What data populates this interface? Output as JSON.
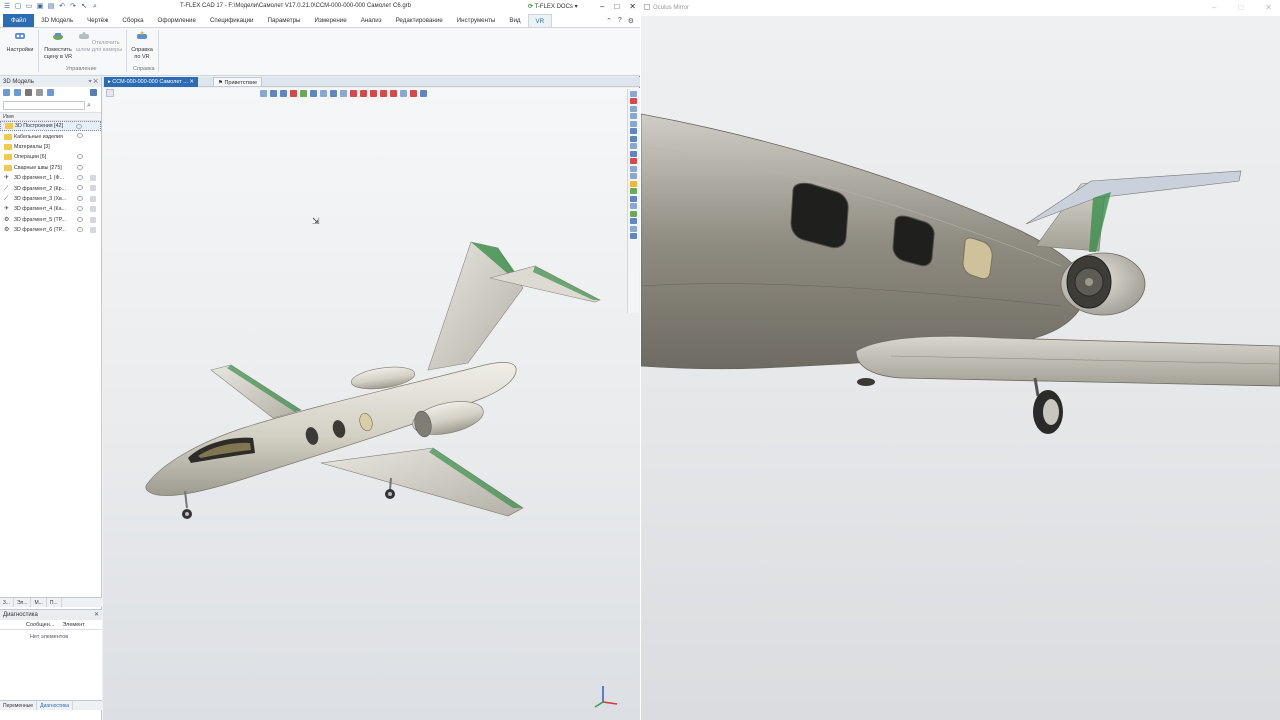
{
  "app": {
    "title": "T-FLEX CAD 17 - F:\\Модели\\Самолет V17.0.21.0\\ССМ-000-000-000 Самолет C6.grb",
    "docs_label": "T-FLEX DOCs",
    "menu": [
      "Файл",
      "3D Модель",
      "Чертёж",
      "Сборка",
      "Оформление",
      "Спецификации",
      "Параметры",
      "Измерение",
      "Анализ",
      "Редактирование",
      "Инструменты",
      "Вид",
      "VR"
    ],
    "ribbon": {
      "settings": "Настройки",
      "place_scene": "Поместить сцену в VR",
      "detach_camera": "Отключить шлем для камеры",
      "group_control": "Управление",
      "vr_help": "Справка по VR",
      "group_help": "Справка"
    }
  },
  "left_panel": {
    "title": "3D Модель",
    "column_header": "Имя",
    "items": [
      {
        "label": "3D Построения [42]",
        "type": "folder"
      },
      {
        "label": "Кабельные изделия",
        "type": "folder"
      },
      {
        "label": "Материалы [3]",
        "type": "folder"
      },
      {
        "label": "Операции [6]",
        "type": "folder"
      },
      {
        "label": "Сварные швы [275]",
        "type": "folder"
      },
      {
        "label": "3D фрагмент_1 (Ф...",
        "type": "fragment"
      },
      {
        "label": "3D фрагмент_2 (Кр...",
        "type": "fragment"
      },
      {
        "label": "3D фрагмент_3 (Хв...",
        "type": "fragment"
      },
      {
        "label": "3D фрагмент_4 (Ка...",
        "type": "fragment"
      },
      {
        "label": "3D фрагмент_5 (ТР...",
        "type": "fragment"
      },
      {
        "label": "3D фрагмент_6 (ТР...",
        "type": "fragment"
      }
    ],
    "tabs": [
      "3...",
      "Эл...",
      "М...",
      "П..."
    ]
  },
  "diagnostics": {
    "title": "Диагностика",
    "col_message": "Сообщен...",
    "col_element": "Элемент",
    "empty": "Нет элементов",
    "bottom_tabs": [
      "Переменные",
      "Диагностика"
    ]
  },
  "document_tabs": {
    "active": "ССМ-000-000-000 Самолет ...",
    "inactive": "Приветствие"
  },
  "oculus": {
    "title": "Oculus Mirror"
  },
  "colors": {
    "accent": "#2b6cb3",
    "aircraft_body": "#d9d6cb",
    "wing_trim": "#3a8f4b"
  }
}
